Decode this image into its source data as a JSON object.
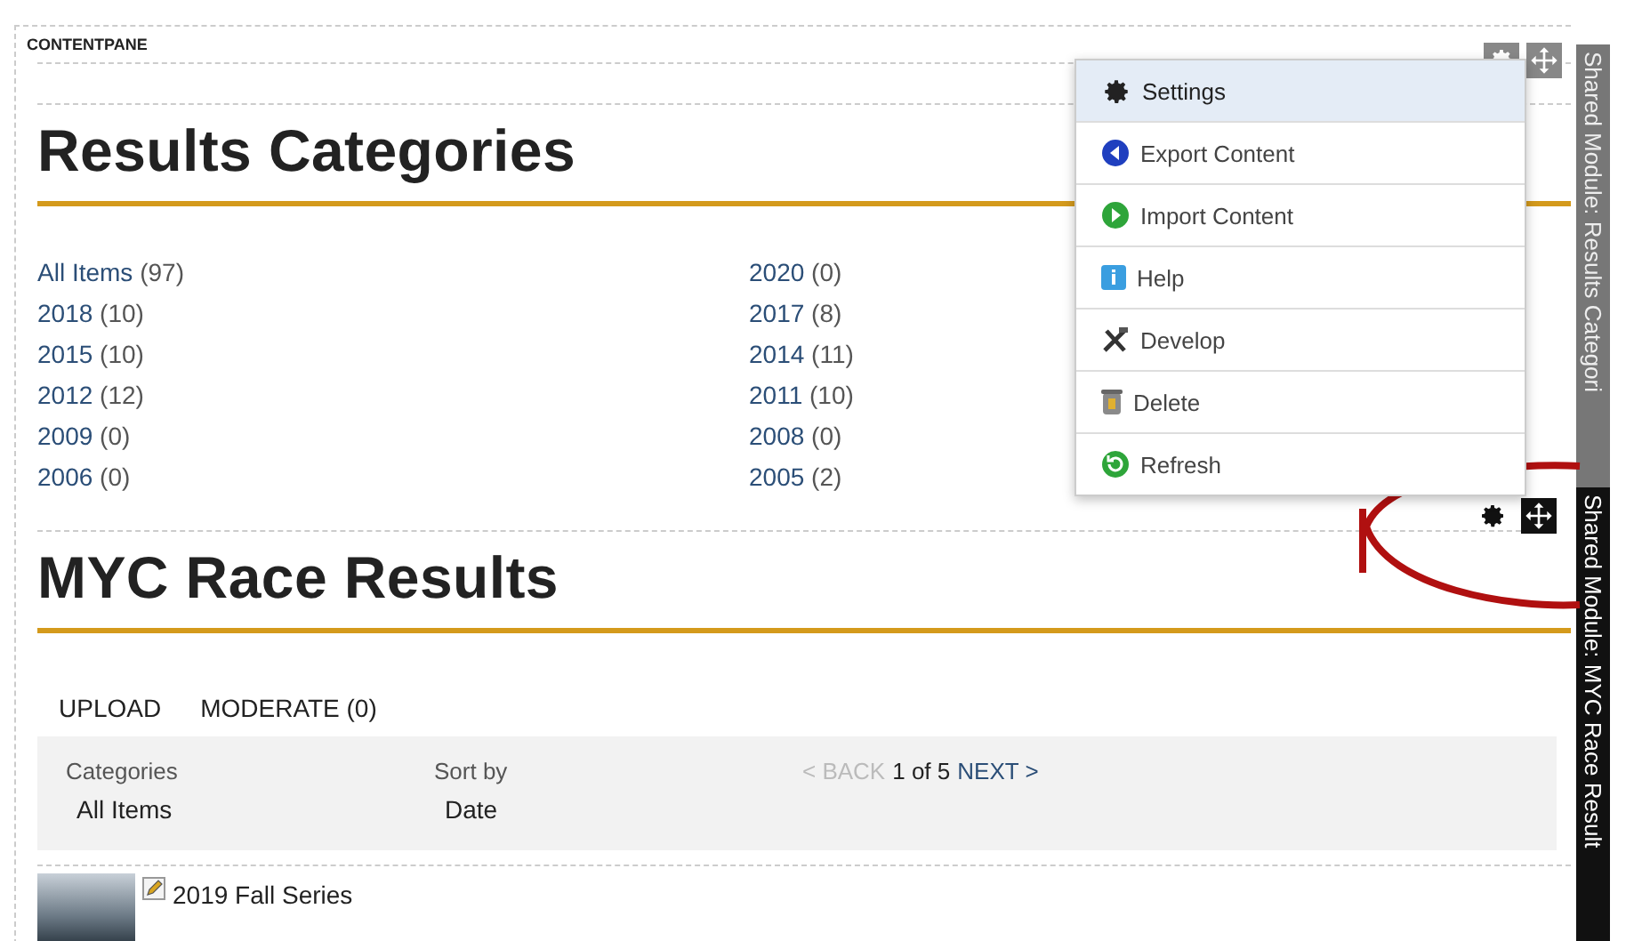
{
  "pane_label": "CONTENTPANE",
  "categories_module": {
    "title": "Results Categories",
    "side_label": "Shared Module: Results Categori",
    "items": [
      {
        "name": "All Items",
        "count": "(97)"
      },
      {
        "name": "2020",
        "count": "(0)"
      },
      {
        "name": "2018",
        "count": "(10)"
      },
      {
        "name": "2017",
        "count": "(8)"
      },
      {
        "name": "2015",
        "count": "(10)"
      },
      {
        "name": "2014",
        "count": "(11)"
      },
      {
        "name": "2012",
        "count": "(12)"
      },
      {
        "name": "2011",
        "count": "(10)"
      },
      {
        "name": "2009",
        "count": "(0)"
      },
      {
        "name": "2008",
        "count": "(0)"
      },
      {
        "name": "2006",
        "count": "(0)"
      },
      {
        "name": "2005",
        "count": "(2)"
      }
    ]
  },
  "action_menu": [
    {
      "kind": "settings",
      "label": "Settings",
      "selected": true
    },
    {
      "kind": "export",
      "label": "Export Content",
      "selected": false
    },
    {
      "kind": "import",
      "label": "Import Content",
      "selected": false
    },
    {
      "kind": "help",
      "label": "Help",
      "selected": false
    },
    {
      "kind": "develop",
      "label": "Develop",
      "selected": false
    },
    {
      "kind": "delete",
      "label": "Delete",
      "selected": false
    },
    {
      "kind": "refresh",
      "label": "Refresh",
      "selected": false
    }
  ],
  "results_module": {
    "title": "MYC Race Results",
    "side_label": "Shared Module: MYC Race Result",
    "actions": [
      "UPLOAD",
      "MODERATE (0)"
    ],
    "filters": [
      {
        "label": "Categories",
        "value": "All Items"
      },
      {
        "label": "Sort by",
        "value": "Date"
      }
    ],
    "pager": {
      "back": {
        "label": "< BACK",
        "disabled": true
      },
      "position": "1 of 5",
      "next": {
        "label": "NEXT >",
        "disabled": false
      }
    },
    "items": [
      {
        "title": "2019 Fall Series"
      }
    ]
  }
}
